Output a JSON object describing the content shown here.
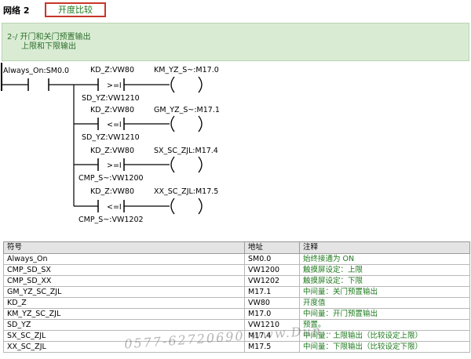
{
  "network": {
    "label": "网络 2",
    "name": "开度比较",
    "comment": [
      "2-/  开门和关门预置输出",
      "上限和下限输出"
    ]
  },
  "ladder": {
    "power_contact": "Always_On:SM0.0",
    "rungs": [
      {
        "in1": "KD_Z:VW80",
        "op": ">=I",
        "in2": "SD_YZ:VW1210",
        "coil": "KM_YZ_S~:M17.0"
      },
      {
        "in1": "KD_Z:VW80",
        "op": "<=I",
        "in2": "SD_YZ:VW1210",
        "coil": "GM_YZ_S~:M17.1"
      },
      {
        "in1": "KD_Z:VW80",
        "op": ">=I",
        "in2": "CMP_S~:VW1200",
        "coil": "SX_SC_ZJL:M17.4"
      },
      {
        "in1": "KD_Z:VW80",
        "op": "<=I",
        "in2": "CMP_S~:VW1202",
        "coil": "XX_SC_ZJL:M17.5"
      }
    ]
  },
  "symbol_table": {
    "headers": [
      "符号",
      "地址",
      "注释"
    ],
    "rows": [
      [
        "Always_On",
        "SM0.0",
        "始终接通为 ON"
      ],
      [
        "CMP_SD_SX",
        "VW1200",
        "触摸屏设定：上限"
      ],
      [
        "CMP_SD_XX",
        "VW1202",
        "触摸屏设定：下限"
      ],
      [
        "GM_YZ_SC_ZJL",
        "M17.1",
        "中间量：关门预置输出"
      ],
      [
        "KD_Z",
        "VW80",
        "开度值"
      ],
      [
        "KM_YZ_SC_ZJL",
        "M17.0",
        "中间量：开门预置输出"
      ],
      [
        "SD_YZ",
        "VW1210",
        "预置。"
      ],
      [
        "SX_SC_ZJL",
        "M17.4",
        "中间量：上限输出（比较设定上限）"
      ],
      [
        "XX_SC_ZJL",
        "M17.5",
        "中间量：下限输出（比较设定下限）"
      ]
    ]
  },
  "watermark": "0577-62720690  www.Dun...",
  "colors": {
    "accent_red": "#c8362b",
    "comment_bg": "#d9ecd3",
    "comment_text": "#1e7a1e"
  }
}
